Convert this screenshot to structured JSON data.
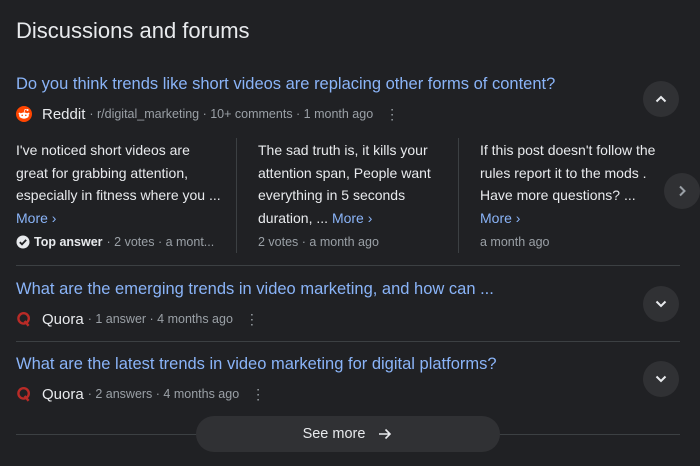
{
  "section_title": "Discussions and forums",
  "threads": [
    {
      "title": "Do you think trends like short videos are replacing other forms of content?",
      "source": "Reddit",
      "meta": "· r/digital_marketing · 10+ comments · 1 month ago",
      "answers": [
        {
          "text": "I've noticed short videos are great for grabbing attention, especially in fitness where you ...",
          "more": "More",
          "badge": "Top answer",
          "meta": "· 2 votes · a mont..."
        },
        {
          "text": "The sad truth is, it kills your attention span, People want everything in 5 seconds duration, ...",
          "more": "More",
          "meta": "2 votes · a month ago"
        },
        {
          "text": "If this post doesn't follow the rules report it to the mods . Have more questions? ...",
          "more": "More",
          "meta": "a month ago"
        }
      ]
    },
    {
      "title": "What are the emerging trends in video marketing, and how can ...",
      "source": "Quora",
      "meta": "· 1 answer · 4 months ago"
    },
    {
      "title": "What are the latest trends in video marketing for digital platforms?",
      "source": "Quora",
      "meta": "· 2 answers · 4 months ago"
    }
  ],
  "see_more": "See more",
  "colors": {
    "background": "#202124",
    "link": "#8ab4f8",
    "reddit": "#ff4500",
    "quora": "#b92b27",
    "button": "#303134"
  },
  "icons": [
    "reddit-icon",
    "quora-icon",
    "chevron-up-icon",
    "chevron-down-icon",
    "chevron-right-icon",
    "check-circle-icon",
    "arrow-right-icon",
    "more-vert-icon"
  ]
}
